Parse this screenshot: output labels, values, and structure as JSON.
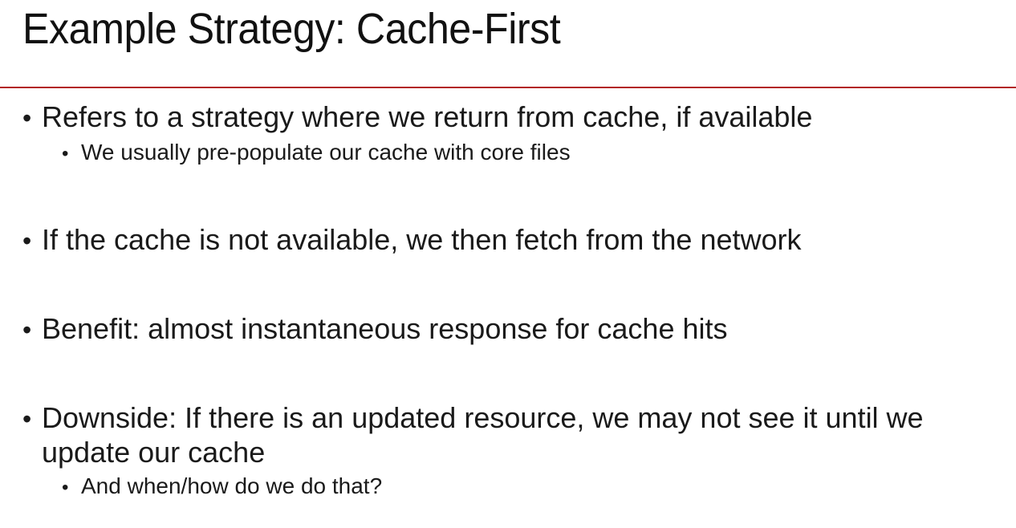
{
  "slide": {
    "title": "Example Strategy: Cache-First",
    "accent_color": "#b22222",
    "bullet_glyph": "•",
    "bullets": [
      {
        "text": "Refers to a strategy where we return from cache, if available",
        "sub": [
          "We usually pre-populate our cache with core files"
        ]
      },
      {
        "text": "If the cache is not available, we then fetch from the network",
        "sub": []
      },
      {
        "text": "Benefit: almost instantaneous response for cache hits",
        "sub": []
      },
      {
        "text": "Downside: If there is an updated resource, we may not see it until we update our cache",
        "sub": [
          "And when/how do we do that?"
        ]
      }
    ]
  }
}
